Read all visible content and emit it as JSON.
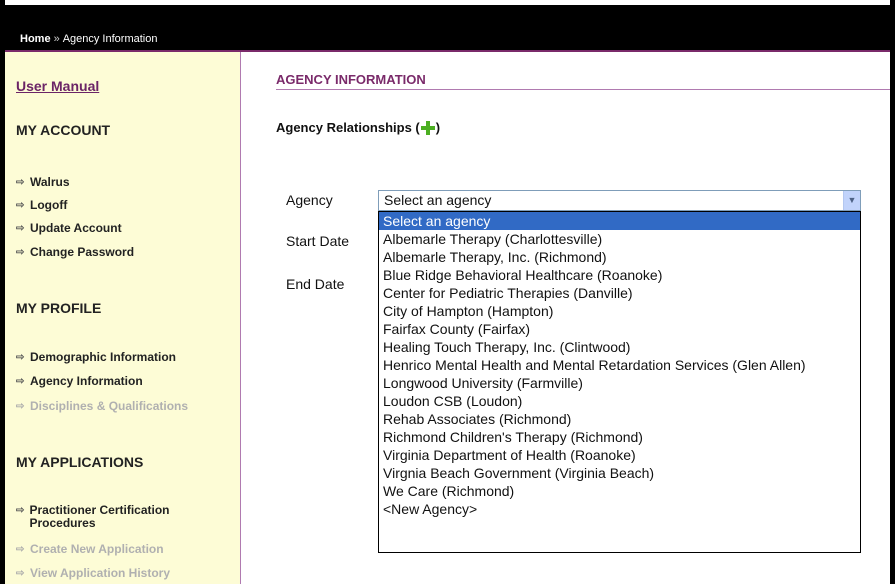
{
  "breadcrumb": {
    "home": "Home",
    "separator": "»",
    "current": "Agency Information"
  },
  "sidebar": {
    "manual_link": "User Manual",
    "account": {
      "heading": "MY ACCOUNT",
      "items": [
        {
          "label": "Walrus",
          "enabled": true
        },
        {
          "label": "Logoff",
          "enabled": true
        },
        {
          "label": "Update Account",
          "enabled": true
        },
        {
          "label": "Change Password",
          "enabled": true
        }
      ]
    },
    "profile": {
      "heading": "MY PROFILE",
      "items": [
        {
          "label": "Demographic Information",
          "enabled": true
        },
        {
          "label": "Agency Information",
          "enabled": true
        },
        {
          "label": "Disciplines & Qualifications",
          "enabled": false
        }
      ]
    },
    "applications": {
      "heading": "MY APPLICATIONS",
      "items": [
        {
          "label": "Practitioner Certification Procedures",
          "enabled": true
        },
        {
          "label": "Create New Application",
          "enabled": false
        },
        {
          "label": "View Application History",
          "enabled": false
        }
      ]
    },
    "arrow_icon": "circle-arrow-icon"
  },
  "main": {
    "title": "AGENCY INFORMATION",
    "relationships_label": "Agency Relationships (",
    "relationships_suffix": ")",
    "add_icon": "green-plus-icon",
    "form": {
      "agency_label": "Agency",
      "start_date_label": "Start Date",
      "end_date_label": "End Date",
      "agency_selected": "Select an agency",
      "agency_options": [
        "Select an agency",
        "Albemarle Therapy (Charlottesville)",
        "Albemarle Therapy, Inc. (Richmond)",
        "Blue Ridge Behavioral Healthcare (Roanoke)",
        "Center for Pediatric Therapies (Danville)",
        "City of Hampton (Hampton)",
        "Fairfax County (Fairfax)",
        "Healing Touch Therapy, Inc. (Clintwood)",
        "Henrico Mental Health and Mental Retardation Services (Glen Allen)",
        "Longwood University (Farmville)",
        "Loudon CSB (Loudon)",
        "Rehab Associates (Richmond)",
        "Richmond Children's Therapy (Richmond)",
        "Virginia Department of Health (Roanoke)",
        "Virgnia Beach Government (Virginia Beach)",
        "We Care (Richmond)",
        "<New Agency>"
      ]
    }
  },
  "colors": {
    "accent": "#7a2a6a",
    "sidebar_bg": "#fdfcd6",
    "selected": "#316ac5",
    "plus": "#4caf22"
  }
}
